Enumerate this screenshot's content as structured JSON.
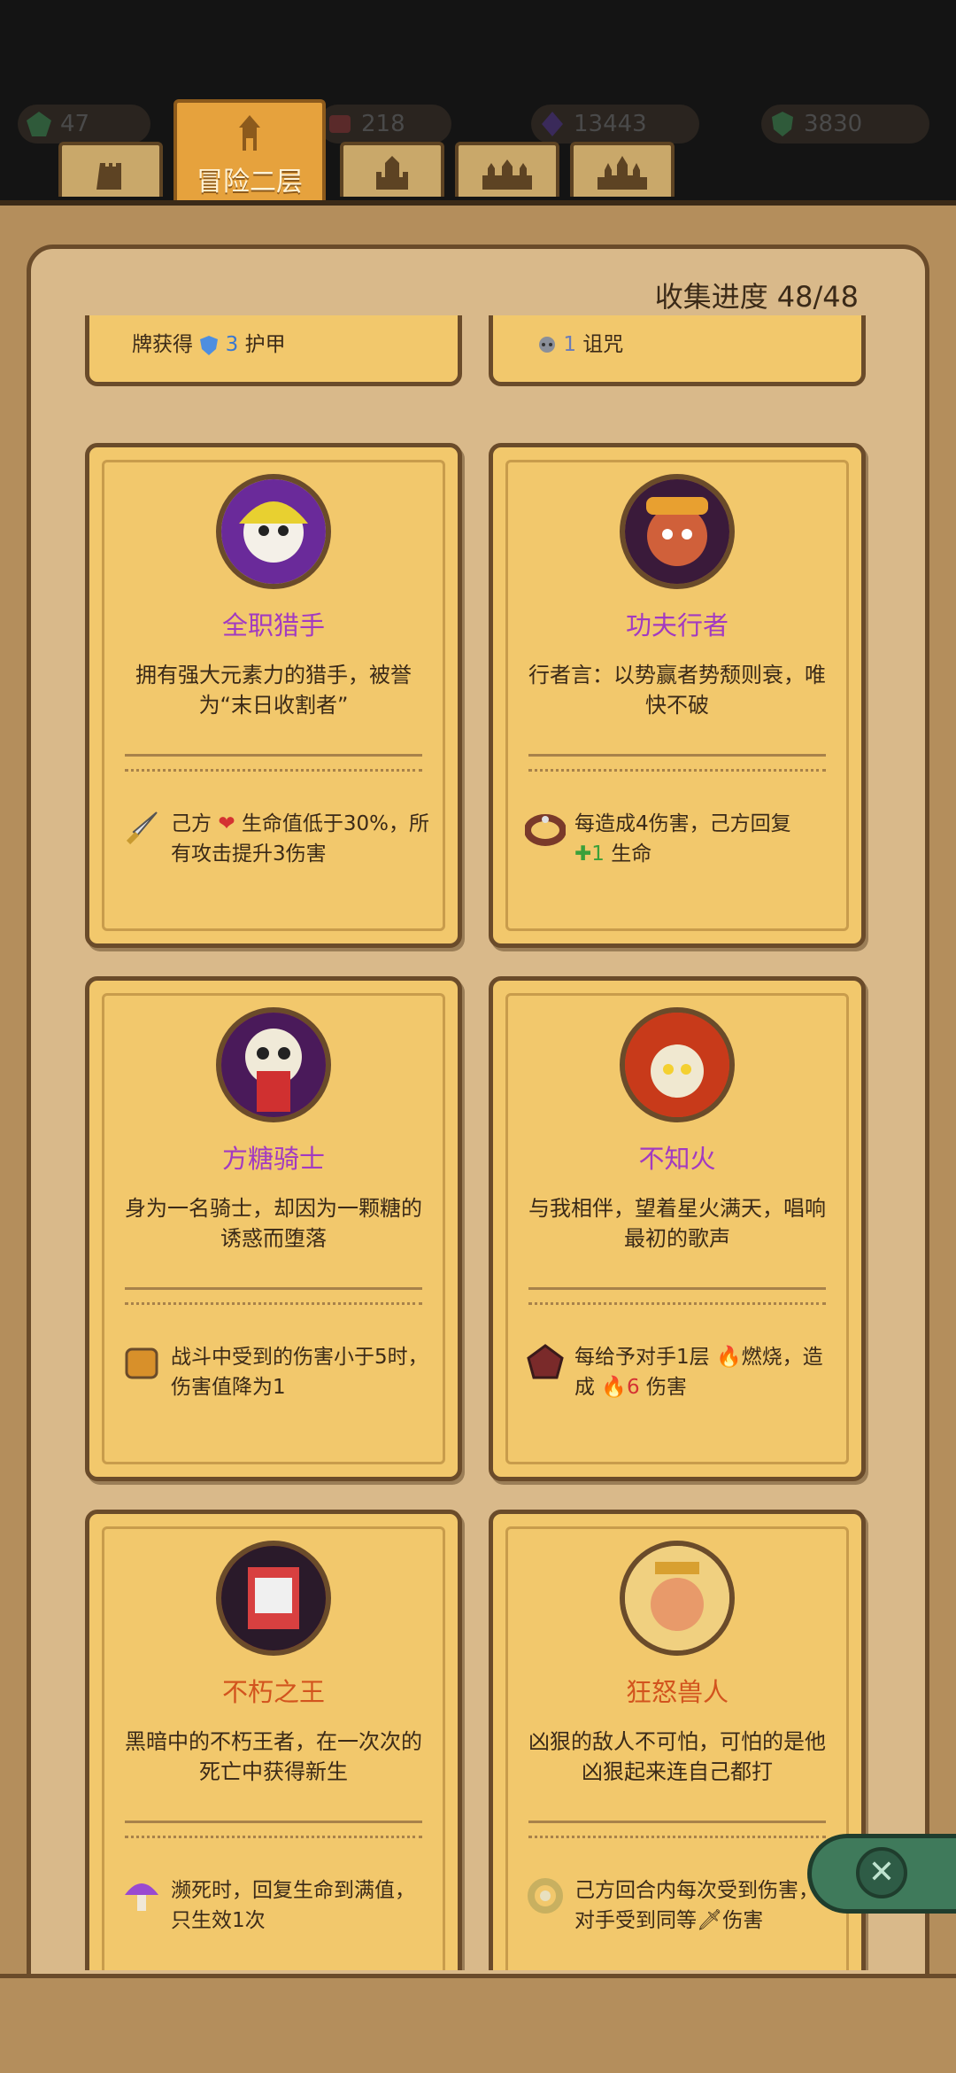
{
  "resources": [
    {
      "value": "47",
      "icon": "green-gem-icon"
    },
    {
      "value": "218",
      "icon": "red-scroll-icon"
    },
    {
      "value": "13443",
      "icon": "purple-crystal-icon"
    },
    {
      "value": "3830",
      "icon": "green-shield-icon"
    }
  ],
  "tabs": [
    {
      "label": "",
      "icon": "tower-icon"
    },
    {
      "label": "冒险二层",
      "icon": "house-icon",
      "active": true
    },
    {
      "label": "",
      "icon": "castle-icon"
    },
    {
      "label": "",
      "icon": "fortress-icon"
    },
    {
      "label": "",
      "icon": "palace-icon"
    }
  ],
  "progress": {
    "label": "收集进度",
    "value": "48/48"
  },
  "partial_cards": [
    {
      "text_a": "牌获得 ",
      "value": "3",
      "text_b": " 护甲",
      "icon": "shield-icon"
    },
    {
      "text_a": "",
      "value": "1",
      "text_b": " 诅咒",
      "icon": "skull-icon"
    }
  ],
  "cards": [
    {
      "name": "全职猎手",
      "name_color": "purple",
      "portrait": "hunter-portrait",
      "desc": "拥有强大元素力的猎手，被誉为“末日收割者”",
      "effect_icon": "dagger-icon",
      "effect_a": "己方 ",
      "effect_b": "生命值低于30%，所有攻击提升3伤害"
    },
    {
      "name": "功夫行者",
      "name_color": "purple",
      "portrait": "kungfu-portrait",
      "desc": "行者言：以势赢者势颓则衰，唯快不破",
      "effect_icon": "bracelet-icon",
      "effect_a": "每造成4伤害，己方回复",
      "effect_value": "1",
      "effect_b": "生命"
    },
    {
      "name": "方糖骑士",
      "name_color": "purple",
      "portrait": "knight-portrait",
      "desc": "身为一名骑士，却因为一颗糖的诱惑而堕落",
      "effect_icon": "armor-icon",
      "effect_a": "战斗中受到的伤害小于5时，伤害值降为1"
    },
    {
      "name": "不知火",
      "name_color": "purple",
      "portrait": "shiranui-portrait",
      "desc": "与我相伴，望着星火满天，唱响最初的歌声",
      "effect_icon": "ember-stone-icon",
      "effect_a": "每给予对手1层 ",
      "effect_mid": "燃烧，造成 ",
      "effect_value": "6",
      "effect_b": " 伤害"
    },
    {
      "name": "不朽之王",
      "name_color": "orange",
      "portrait": "undying-king-portrait",
      "desc": "黑暗中的不朽王者，在一次次的死亡中获得新生",
      "effect_icon": "mushroom-icon",
      "effect_a": "濒死时，回复生命到满值，只生效1次"
    },
    {
      "name": "狂怒兽人",
      "name_color": "orange",
      "portrait": "orc-portrait",
      "desc": "凶狠的敌人不可怕，可怕的是他凶狠起来连自己都打",
      "effect_icon": "ring-icon",
      "effect_a": "己方回合内每次受到伤害，对手受到同等",
      "effect_b": "伤害"
    }
  ]
}
